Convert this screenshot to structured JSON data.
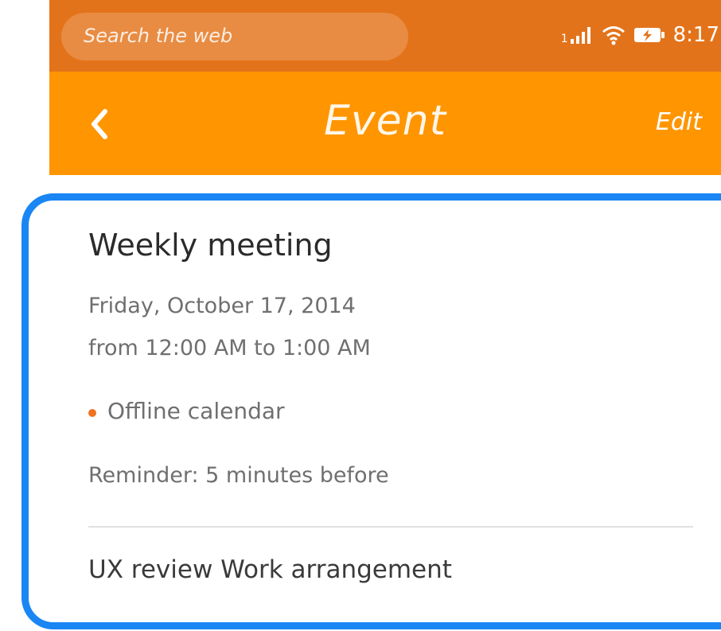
{
  "status_bar": {
    "search_placeholder": "Search the web",
    "sim_label": "1",
    "time": "8:17",
    "icons": [
      "signal-icon",
      "wifi-icon",
      "battery-charging-icon"
    ],
    "color": "#e3731a"
  },
  "header": {
    "back_icon": "chevron-left-icon",
    "title": "Event",
    "edit_label": "Edit",
    "color": "#ff9500"
  },
  "event": {
    "title": "Weekly meeting",
    "date": "Friday, October 17, 2014",
    "time": "from 12:00 AM to 1:00 AM",
    "calendar": "Offline calendar",
    "calendar_color": "#f0731f",
    "reminder": "Reminder: 5 minutes before",
    "description": "UX review Work arrangement"
  },
  "highlight_color": "#1a86f4"
}
